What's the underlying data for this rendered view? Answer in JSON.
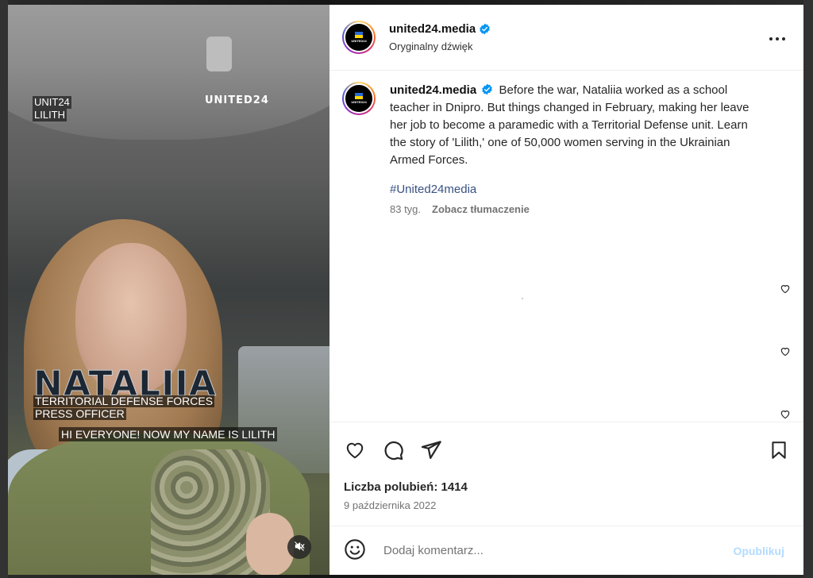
{
  "video": {
    "overlay_unit_line1": "UNIT24",
    "overlay_unit_line2": "LILITH",
    "brand_watermark": "UNITED24",
    "name_title": "NATALIIA",
    "role_line1": "TERRITORIAL DEFENSE FORCES",
    "role_line2": "PRESS OFFICER",
    "subtitle": "HI EVERYONE! NOW MY NAME IS LILITH",
    "mute_icon": "speaker-muted-icon"
  },
  "header": {
    "username": "united24.media",
    "verified": true,
    "audio_label": "Oryginalny dźwięk",
    "avatar_text": "UNITED24",
    "more_icon": "more-horizontal-icon"
  },
  "caption": {
    "username": "united24.media",
    "text": "Before the war, Nataliia worked as a school teacher in Dnipro. But things changed in February, making her leave her job to become a paramedic with a Territorial Defense unit. Learn the story of 'Lilith,' one of 50,000 women serving in the Ukrainian Armed Forces.",
    "hashtag": "#United24media",
    "age": "83 tyg.",
    "translate_label": "Zobacz tłumaczenie"
  },
  "actions": {
    "like_icon": "heart-icon",
    "comment_icon": "comment-icon",
    "share_icon": "send-icon",
    "save_icon": "bookmark-icon"
  },
  "likes": "Liczba polubień: 1414",
  "date": "9 października 2022",
  "comment": {
    "placeholder": "Dodaj komentarz...",
    "publish_label": "Opublikuj",
    "emoji_icon": "emoji-icon"
  },
  "colors": {
    "link": "#385185",
    "verified": "#0095f6",
    "publish_disabled": "#b3dbff"
  }
}
